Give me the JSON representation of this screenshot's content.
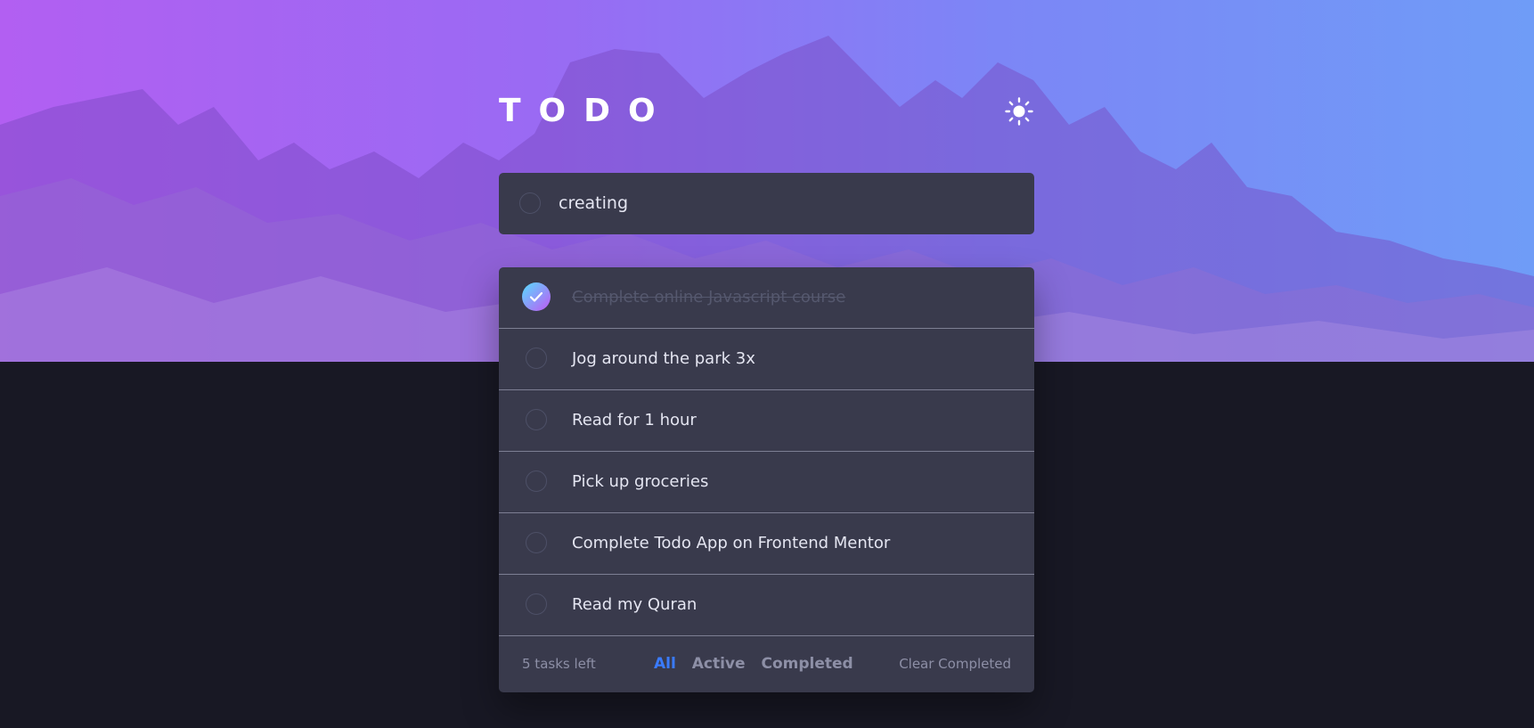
{
  "app": {
    "title": "TODO",
    "theme_toggle_icon": "sun-icon"
  },
  "new_todo": {
    "value": "creating"
  },
  "todos": [
    {
      "label": "Complete online Javascript course",
      "completed": true
    },
    {
      "label": "Jog around the park 3x",
      "completed": false
    },
    {
      "label": "Read for 1 hour",
      "completed": false
    },
    {
      "label": "Pick up groceries",
      "completed": false
    },
    {
      "label": "Complete Todo App on Frontend Mentor",
      "completed": false
    },
    {
      "label": "Read my Quran",
      "completed": false
    }
  ],
  "footer": {
    "items_left": "5 tasks left",
    "filters": {
      "all": "All",
      "active": "Active",
      "completed": "Completed"
    },
    "active_filter": "All",
    "clear_label": "Clear Completed"
  },
  "colors": {
    "accent": "#3a7bfd",
    "check_gradient_start": "#57ddff",
    "check_gradient_end": "#c058f3",
    "panel": "#393a4c",
    "background": "#181824"
  }
}
